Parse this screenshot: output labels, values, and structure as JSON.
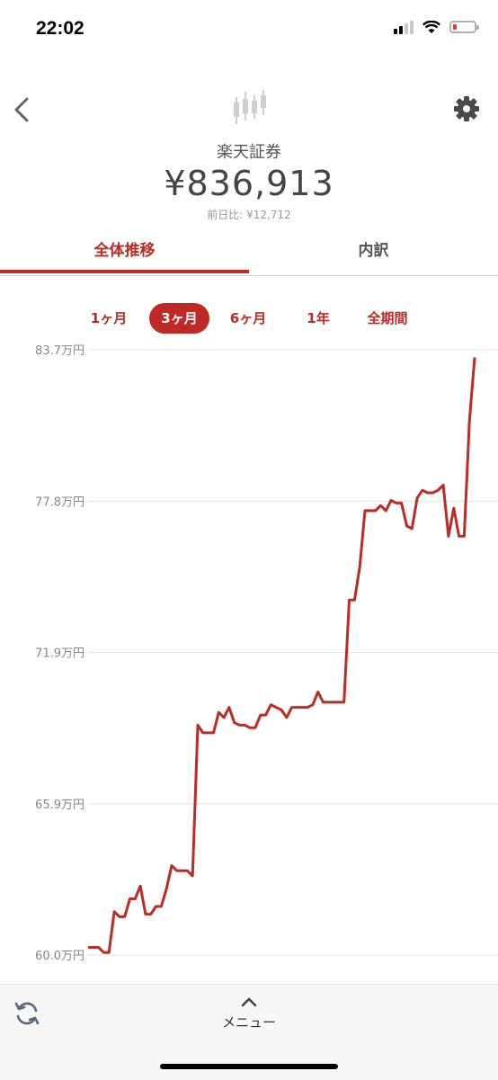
{
  "status_bar": {
    "time": "22:02"
  },
  "header": {
    "account_name": "楽天証券",
    "balance": "¥836,913",
    "day_change": "前日比: ¥12,712"
  },
  "tabs": [
    {
      "label": "全体推移",
      "active": true
    },
    {
      "label": "内訳",
      "active": false
    }
  ],
  "periods": [
    {
      "label": "1ヶ月",
      "selected": false
    },
    {
      "label": "3ヶ月",
      "selected": true
    },
    {
      "label": "6ヶ月",
      "selected": false
    },
    {
      "label": "1年",
      "selected": false
    },
    {
      "label": "全期間",
      "selected": false
    }
  ],
  "chart_data": {
    "type": "line",
    "yticks": [
      "83.7万円",
      "77.8万円",
      "71.9万円",
      "65.9万円",
      "60.0万円"
    ],
    "ylim": [
      60.0,
      83.7
    ],
    "grid": true,
    "color": "#bf2a24",
    "series": [
      {
        "values": [
          60.3,
          60.3,
          60.3,
          60.1,
          60.1,
          61.7,
          61.5,
          61.5,
          62.2,
          62.2,
          62.7,
          61.6,
          61.6,
          61.9,
          61.9,
          62.6,
          63.5,
          63.3,
          63.3,
          63.3,
          63.1,
          69.0,
          68.7,
          68.7,
          68.7,
          69.5,
          69.3,
          69.7,
          69.1,
          69.0,
          69.0,
          68.9,
          68.9,
          69.4,
          69.4,
          69.8,
          69.7,
          69.6,
          69.3,
          69.7,
          69.7,
          69.7,
          69.7,
          69.8,
          70.3,
          69.9,
          69.9,
          69.9,
          69.9,
          69.9,
          73.9,
          73.9,
          75.2,
          77.4,
          77.4,
          77.4,
          77.6,
          77.4,
          77.8,
          77.7,
          77.7,
          76.8,
          76.7,
          77.9,
          78.2,
          78.1,
          78.1,
          78.2,
          78.4,
          76.4,
          77.5,
          76.4,
          76.4,
          80.9,
          83.4
        ]
      }
    ]
  },
  "bottom_bar": {
    "menu_label": "メニュー"
  }
}
